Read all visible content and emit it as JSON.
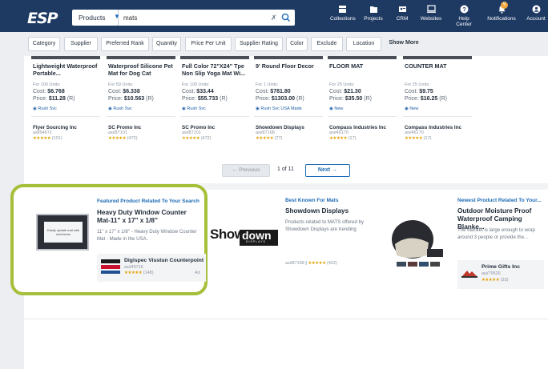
{
  "header": {
    "logo": "ESP",
    "search": {
      "category": "Products",
      "query": "mats"
    },
    "nav": [
      {
        "label": "Collections",
        "icon": "collections-icon"
      },
      {
        "label": "Projects",
        "icon": "folder-icon"
      },
      {
        "label": "CRM",
        "icon": "contact-card-icon"
      },
      {
        "label": "Websites",
        "icon": "monitor-icon"
      },
      {
        "label": "Help Center",
        "icon": "help-icon"
      },
      {
        "label": "Notifications",
        "icon": "bell-icon"
      },
      {
        "label": "Account",
        "icon": "user-icon"
      }
    ],
    "notification_count": "9"
  },
  "filters": [
    "Category",
    "Supplier",
    "Preferred Rank",
    "Quantity",
    "Price Per Unit",
    "Supplier Rating",
    "Color",
    "Exclude",
    "Location",
    "Show More"
  ],
  "products": [
    {
      "name": "Lightweight Waterproof Portable...",
      "units": "For 100 Units:",
      "cost_label": "Cost:",
      "cost": "$6.768",
      "price_label": "Price:",
      "price": "$11.28",
      "price_suffix": "(R)",
      "badges": "Rush Svc",
      "supplier": "Flyer Sourcing Inc",
      "asi": "asi/54671",
      "rating": "(101)"
    },
    {
      "name": "Waterproof Silicone Pet Mat for Dog Cat",
      "units": "For 50 Units:",
      "cost_label": "Cost:",
      "cost": "$6.338",
      "price_label": "Price:",
      "price": "$10.563",
      "price_suffix": "(R)",
      "badges": "Rush Svc",
      "supplier": "SC Promo Inc",
      "asi": "asi/87101",
      "rating": "(472)"
    },
    {
      "name": "Full Color 72\"X24\" Tpe Non Slip Yoga Mat Wi...",
      "units": "For 100 Units:",
      "cost_label": "Cost:",
      "cost": "$33.44",
      "price_label": "Price:",
      "price": "$55.733",
      "price_suffix": "(R)",
      "badges": "Rush Svc",
      "supplier": "SC Promo Inc",
      "asi": "asi/87101",
      "rating": "(472)"
    },
    {
      "name": "9' Round Floor Decor",
      "units": "For 1 Units:",
      "cost_label": "Cost:",
      "cost": "$781.80",
      "price_label": "Price:",
      "price": "$1303.00",
      "price_suffix": "(R)",
      "badges": "Rush Svc   USA Made",
      "supplier": "Showdown Displays",
      "asi": "asi/87168",
      "rating": "(77)"
    },
    {
      "name": "FLOOR MAT",
      "units": "For 25 Units:",
      "cost_label": "Cost:",
      "cost": "$21.30",
      "price_label": "Price:",
      "price": "$35.50",
      "price_suffix": "(R)",
      "badges": "New",
      "supplier": "Compass Industries Inc",
      "asi": "asi/46170",
      "rating": "(17)"
    },
    {
      "name": "COUNTER MAT",
      "units": "For 25 Units:",
      "cost_label": "Cost:",
      "cost": "$9.75",
      "price_label": "Price:",
      "price": "$16.25",
      "price_suffix": "(R)",
      "badges": "New",
      "supplier": "Compass Industries Inc",
      "asi": "asi/46170",
      "rating": "(17)"
    }
  ],
  "pagination": {
    "prev": "Previous",
    "info": "1 of 11",
    "next": "Next"
  },
  "featured": {
    "title": "Featured Product Related To Your Search",
    "name": "Heavy Duty Window Counter Mat-11\" x 17\" x 1/8\"",
    "desc": "11\" x 17\" x 1/8\" - Heavy Duty Window Counter Mat - Made in the USA.",
    "img_text": "Easily update mat with new items",
    "supplier": "Digispec Visstun Counterpoint",
    "asi": "asi/49716",
    "rating": "(148)",
    "ad": "Ad"
  },
  "best": {
    "title": "Best Known For Mats",
    "name": "Showdown Displays",
    "desc": "Products related to MATS offered by Showdown Displays are trending",
    "logo_show": "Show",
    "logo_down": "down",
    "logo_sub": "DISPLAYS",
    "asi": "asi/87168",
    "rating": "(422)"
  },
  "newest": {
    "title": "Newest Product Related To Your...",
    "name": "Outdoor Moisture Proof Waterproof Camping Blanke...",
    "desc": "The blanket is large enough to wrap around 3 people or provide the...",
    "supplier": "Prime Gifts Inc",
    "asi": "asi/79526",
    "rating": "(33)"
  },
  "stars": "★★★★★",
  "colors": {
    "topbar": "#1e3a63",
    "accent": "#1d6bb5",
    "highlight": "#a6bf3a",
    "star": "#e2a200"
  }
}
